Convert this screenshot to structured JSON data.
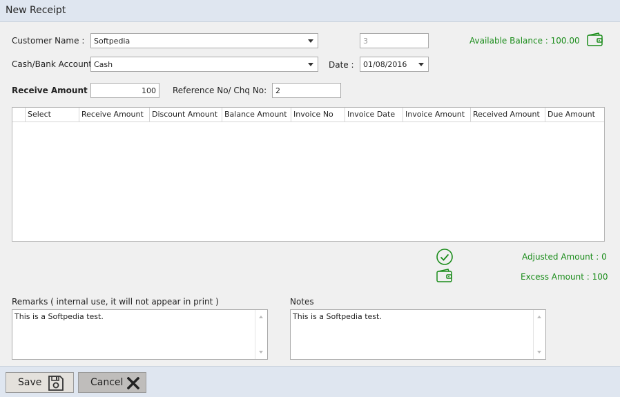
{
  "window": {
    "title": "New Receipt"
  },
  "customer": {
    "label": "Customer Name  :",
    "value": "Softpedia"
  },
  "receipt_no": {
    "value": "3"
  },
  "balance": {
    "text": "Available Balance : 100.00"
  },
  "account": {
    "label": "Cash/Bank Account",
    "value": "Cash"
  },
  "date": {
    "label": "Date :",
    "value": "01/08/2016"
  },
  "receive_amount": {
    "label": "Receive Amount :",
    "value": "100"
  },
  "reference": {
    "label": "Reference No/ Chq No:",
    "value": "2"
  },
  "grid": {
    "columns": [
      "Select",
      "Receive Amount",
      "Discount Amount",
      "Balance Amount",
      "Invoice No",
      "Invoice Date",
      "Invoice Amount",
      "Received Amount",
      "Due Amount"
    ],
    "rows": []
  },
  "summary": {
    "adjusted": "Adjusted Amount : 0",
    "excess": "Excess Amount : 100"
  },
  "remarks": {
    "label": "Remarks ( internal use, it will not appear in print )",
    "value": "This is a Softpedia test."
  },
  "notes": {
    "label": "Notes",
    "value": "This is a Softpedia test."
  },
  "buttons": {
    "save": "Save",
    "cancel": "Cancel"
  },
  "colors": {
    "accent_green": "#1a8c1a",
    "header_bg": "#dfe6f0"
  },
  "icons": [
    "wallet-icon",
    "check-circle-icon",
    "wallet-icon",
    "floppy-disk-icon",
    "close-x-icon",
    "chevron-down-icon"
  ]
}
